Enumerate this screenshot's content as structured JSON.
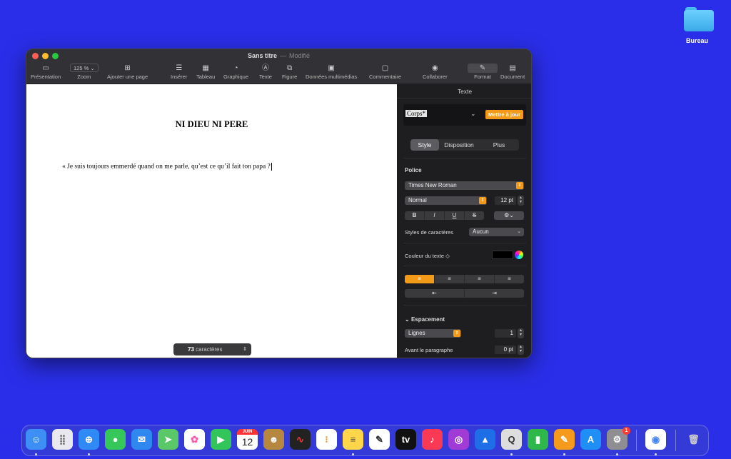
{
  "desktop": {
    "folder_label": "Bureau"
  },
  "window": {
    "title": "Sans titre",
    "separator": "—",
    "status": "Modifié"
  },
  "toolbar": {
    "presentation": "Présentation",
    "zoom_value": "125 %",
    "zoom": "Zoom",
    "add_page": "Ajouter une page",
    "insert": "Insérer",
    "table": "Tableau",
    "chart": "Graphique",
    "text": "Texte",
    "shape": "Figure",
    "media": "Données multimédias",
    "comment": "Commentaire",
    "collaborate": "Collaborer",
    "format": "Format",
    "document": "Document"
  },
  "document": {
    "title": "NI DIEU NI PERE",
    "body": "« Je suis toujours emmerdé quand on me parle, qu’est ce qu’il fait ton papa ?",
    "char_count": "73",
    "char_label": "caractères"
  },
  "inspector": {
    "header": "Texte",
    "paragraph_style": "Corps*",
    "update_button": "Mettre à jour",
    "tabs": [
      "Style",
      "Disposition",
      "Plus"
    ],
    "font_section": "Police",
    "font_family": "Times New Roman",
    "font_weight": "Normal",
    "font_size": "12 pt",
    "bold": "B",
    "italic": "I",
    "underline": "U",
    "strike": "S",
    "char_styles_label": "Styles de caractères",
    "char_styles_value": "Aucun",
    "text_color_label": "Couleur du texte ◇",
    "spacing_section": "Espacement",
    "spacing_mode": "Lignes",
    "spacing_value": "1",
    "before_para_label": "Avant le paragraphe",
    "before_para_value": "0 pt"
  },
  "dock": {
    "calendar_month": "JUIN",
    "calendar_day": "12",
    "settings_badge": "1"
  },
  "colors": {
    "desktop": "#2a2ee8",
    "accent": "#f39a18"
  }
}
